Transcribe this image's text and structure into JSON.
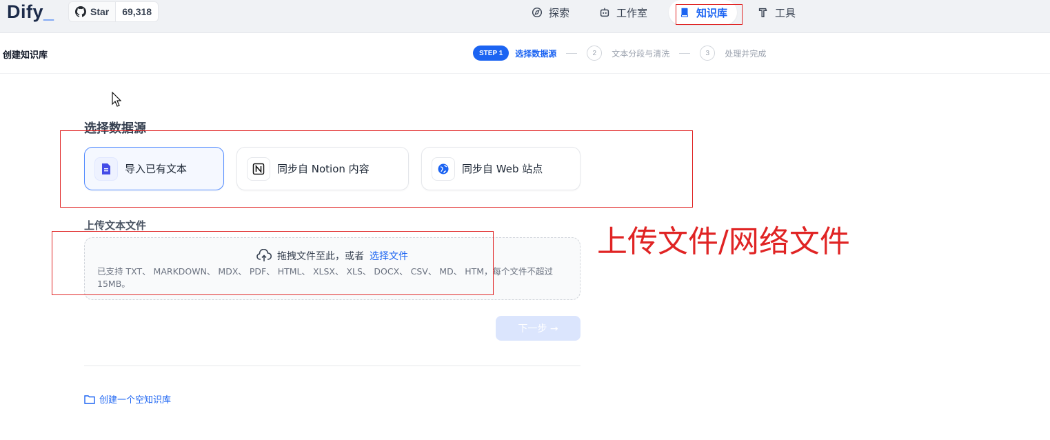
{
  "app": {
    "logo_text": "Dify",
    "logo_suffix": "_"
  },
  "github": {
    "star_label": "Star",
    "star_count": "69,318"
  },
  "nav": {
    "items": [
      {
        "label": "探索",
        "icon": "explore-icon"
      },
      {
        "label": "工作室",
        "icon": "robot-icon"
      },
      {
        "label": "知识库",
        "icon": "book-icon",
        "active": true
      },
      {
        "label": "工具",
        "icon": "hammer-icon"
      }
    ]
  },
  "page": {
    "title": "创建知识库"
  },
  "steps": {
    "badge": "STEP 1",
    "active_label": "选择数据源",
    "items": [
      {
        "num": "2",
        "label": "文本分段与清洗"
      },
      {
        "num": "3",
        "label": "处理并完成"
      }
    ]
  },
  "datasource": {
    "title": "选择数据源",
    "options": [
      {
        "label": "导入已有文本",
        "icon": "document-icon",
        "selected": true
      },
      {
        "label": "同步自 Notion 内容",
        "icon": "notion-icon",
        "selected": false
      },
      {
        "label": "同步自 Web 站点",
        "icon": "web-icon",
        "selected": false
      }
    ]
  },
  "upload": {
    "title": "上传文本文件",
    "drag_text": "拖拽文件至此，或者",
    "select_link": "选择文件",
    "tip": "已支持 TXT、 MARKDOWN、 MDX、 PDF、 HTML、 XLSX、 XLS、 DOCX、 CSV、 MD、 HTM，每个文件不超过 15MB。"
  },
  "next_button": {
    "label": "下一步 →"
  },
  "create_empty": {
    "label": "创建一个空知识库"
  },
  "annotation": {
    "text": "上传文件/网络文件"
  },
  "colors": {
    "accent": "#1c64f2",
    "annotation_red": "#e02424"
  }
}
